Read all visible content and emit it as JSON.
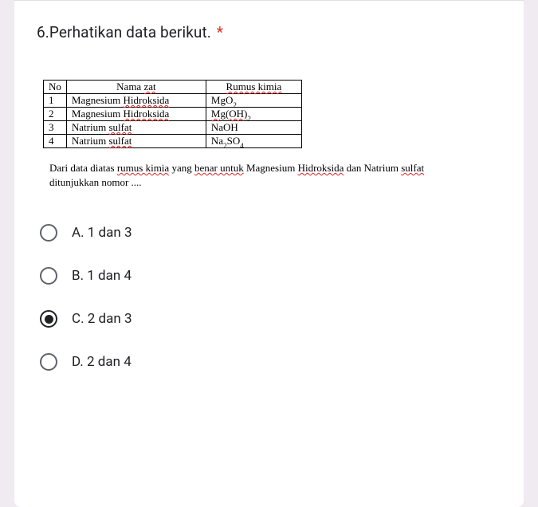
{
  "question": {
    "title": "6.Perhatikan data berikut.",
    "required_marker": "*"
  },
  "table": {
    "headers": {
      "no": "No",
      "nama": "Nama ",
      "nama_u": "zat",
      "rumus": "Rumus kimia"
    },
    "rows": [
      {
        "no": "1",
        "nama": "Magnesium ",
        "nama_u": "Hidroksida",
        "rumus_pre": "MgO",
        "rumus_sub": "2",
        "rumus_post": ""
      },
      {
        "no": "2",
        "nama": "Magnesium ",
        "nama_u": "Hidroksida",
        "rumus_pre": "Mg",
        "rumus_u": "(OH)",
        "rumus_sub": "2",
        "rumus_post": ""
      },
      {
        "no": "3",
        "nama": "Natrium ",
        "nama_u": "sulfat",
        "rumus_pre": "NaOH",
        "rumus_sub": "",
        "rumus_post": ""
      },
      {
        "no": "4",
        "nama": "Natrium ",
        "nama_u": "sulfat",
        "rumus_pre": "Na",
        "rumus_sub": "2",
        "rumus_post": "SO",
        "rumus_sub2": "4"
      }
    ]
  },
  "body_text": {
    "p1a": "Dari data diatas ",
    "p1b": "rumus kimia",
    "p1c": " yang ",
    "p1d": "benar untuk",
    "p1e": " Magnesium ",
    "p1f": "Hidroksida",
    "p1g": " dan Natrium ",
    "p1h": "sulfat",
    "p2": "ditunjukkan nomor ...."
  },
  "options": [
    {
      "label": "A. 1 dan 3",
      "selected": false
    },
    {
      "label": "B. 1 dan 4",
      "selected": false
    },
    {
      "label": "C. 2 dan 3",
      "selected": true
    },
    {
      "label": "D. 2 dan 4",
      "selected": false
    }
  ]
}
